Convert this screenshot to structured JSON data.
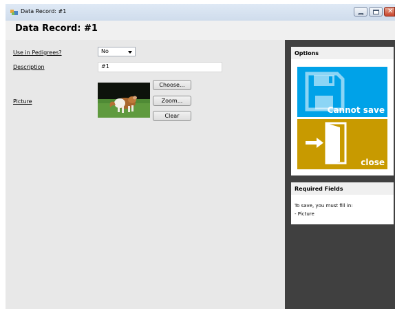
{
  "window": {
    "title": "Data Record: #1"
  },
  "header": {
    "title": "Data Record: #1"
  },
  "form": {
    "use_in_pedigrees_label": "Use in Pedigrees?",
    "use_in_pedigrees_value": "No",
    "description_label": "Description",
    "description_value": "#1",
    "picture_label": "Picture",
    "choose_button": "Choose...",
    "zoom_button": "Zoom...",
    "clear_button": "Clear"
  },
  "options": {
    "title": "Options",
    "save_tile": {
      "label": "Cannot save",
      "color": "#00a2e8",
      "icon": "floppy-disk-icon"
    },
    "close_tile": {
      "label": "close",
      "color": "#c89a00",
      "icon": "exit-door-icon"
    }
  },
  "required": {
    "title": "Required Fields",
    "intro": "To save, you must fill in:",
    "items": [
      "- Picture"
    ]
  }
}
